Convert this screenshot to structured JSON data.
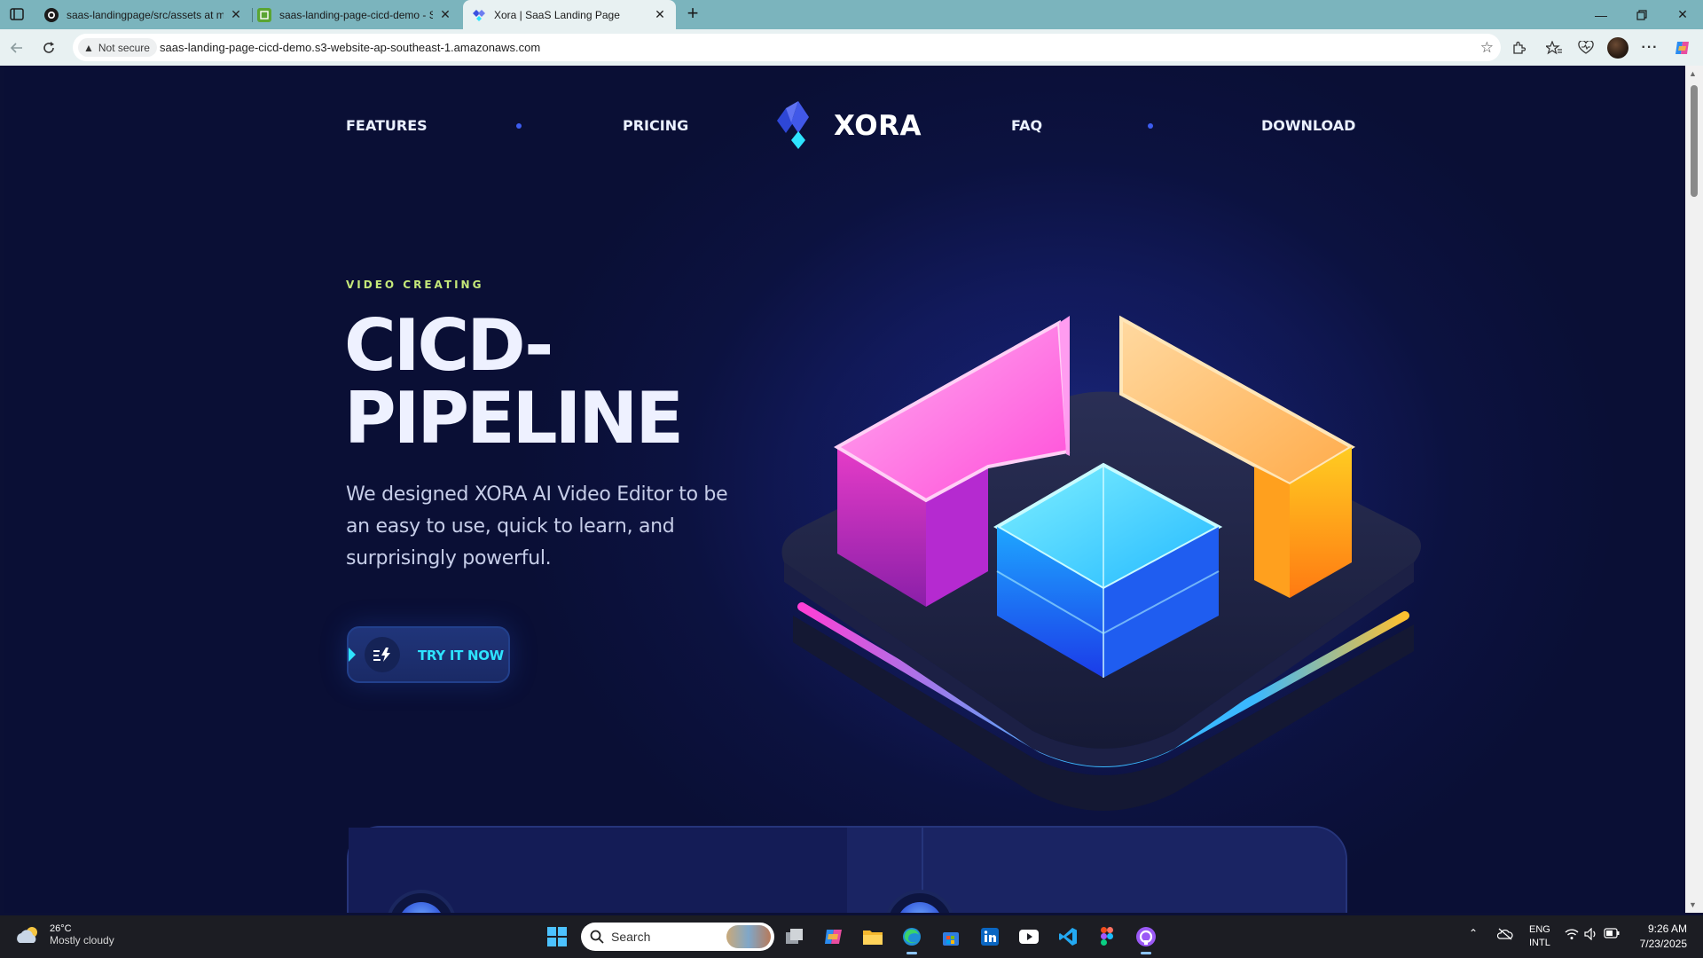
{
  "browser": {
    "tabs": [
      {
        "title": "saas-landingpage/src/assets at m",
        "icon": "github-icon",
        "active": false
      },
      {
        "title": "saas-landing-page-cicd-demo - S",
        "icon": "s3-bucket-icon",
        "active": false
      },
      {
        "title": "Xora | SaaS Landing Page",
        "icon": "xora-icon",
        "active": true
      }
    ],
    "security_label": "Not secure",
    "url": "saas-landing-page-cicd-demo.s3-website-ap-southeast-1.amazonaws.com"
  },
  "nav": {
    "features": "FEATURES",
    "pricing": "PRICING",
    "brand": "XORA",
    "faq": "FAQ",
    "download": "DOWNLOAD"
  },
  "hero": {
    "eyebrow": "VIDEO CREATING",
    "title_line1": "CICD-",
    "title_line2": "PIPELINE",
    "description": "We designed XORA AI Video Editor to be an easy to use, quick to learn, and surprisingly powerful.",
    "cta_label": "TRY IT NOW"
  },
  "colors": {
    "accent_cyan": "#2ee3ff",
    "eyebrow_green": "#c5e879",
    "nav_dot_blue": "#3c5cf0",
    "page_bg": "#0a0f35"
  },
  "taskbar": {
    "weather_temp": "26°C",
    "weather_desc": "Mostly cloudy",
    "search_placeholder": "Search",
    "lang_line1": "ENG",
    "lang_line2": "INTL",
    "time": "9:26 AM",
    "date": "7/23/2025"
  }
}
